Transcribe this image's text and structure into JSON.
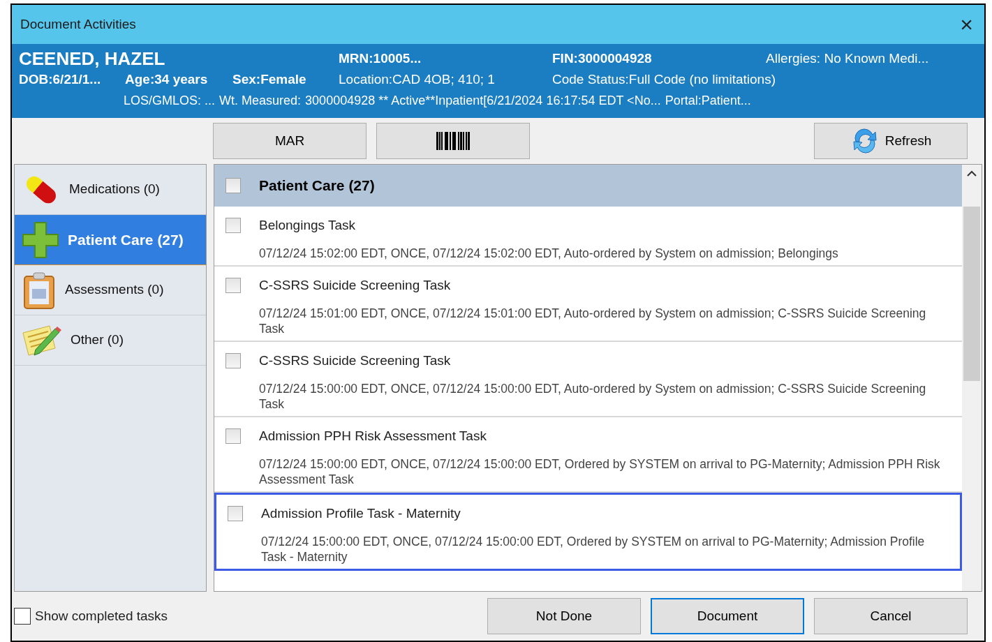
{
  "window": {
    "title": "Document Activities",
    "close": "×"
  },
  "banner": {
    "name": "CEENED, HAZEL",
    "mrn": "MRN:10005...",
    "fin": "FIN:3000004928",
    "allergies": "Allergies: No Known Medi...",
    "dob": "DOB:6/21/1...",
    "age": "Age:34 years",
    "sex": "Sex:Female",
    "location": "Location:CAD 4OB; 410; 1",
    "code_status": "Code Status:Full Code (no limitations)",
    "los": "LOS/GMLOS: ...",
    "weight": "Wt. Measured:",
    "encounter": "3000004928 ** Active**Inpatient[6/21/2024 16:17:54 EDT <No...",
    "portal": "Portal:Patient..."
  },
  "toolbar": {
    "mar": "MAR",
    "refresh": "Refresh"
  },
  "sidebar": {
    "items": [
      {
        "label": "Medications (0)",
        "kind": "pill",
        "selected": false
      },
      {
        "label": "Patient Care (27)",
        "kind": "cross",
        "selected": true
      },
      {
        "label": "Assessments (0)",
        "kind": "clipboard",
        "selected": false
      },
      {
        "label": "Other (0)",
        "kind": "note",
        "selected": false
      }
    ]
  },
  "list": {
    "header": {
      "title": "Patient Care (27)",
      "checked": false
    },
    "tasks": [
      {
        "title": "Belongings Task",
        "details": "07/12/24 15:02:00 EDT, ONCE, 07/12/24 15:02:00 EDT, Auto-ordered by System on admission; Belongings",
        "checked": false,
        "highlighted": false
      },
      {
        "title": "C-SSRS Suicide Screening Task",
        "details": "07/12/24 15:01:00 EDT, ONCE, 07/12/24 15:01:00 EDT, Auto-ordered by System on admission; C-SSRS Suicide Screening Task",
        "checked": false,
        "highlighted": false
      },
      {
        "title": "C-SSRS Suicide Screening Task",
        "details": "07/12/24 15:00:00 EDT, ONCE, 07/12/24 15:00:00 EDT, Auto-ordered by System on admission; C-SSRS Suicide Screening Task",
        "checked": false,
        "highlighted": false
      },
      {
        "title": "Admission PPH Risk Assessment Task",
        "details": "07/12/24 15:00:00 EDT, ONCE, 07/12/24 15:00:00 EDT, Ordered by SYSTEM on arrival to PG-Maternity; Admission PPH Risk Assessment Task",
        "checked": false,
        "highlighted": false
      },
      {
        "title": "Admission Profile Task - Maternity",
        "details": "07/12/24 15:00:00 EDT, ONCE, 07/12/24 15:00:00 EDT, Ordered by SYSTEM on arrival to PG-Maternity; Admission Profile Task - Maternity",
        "checked": false,
        "highlighted": true
      }
    ]
  },
  "footer": {
    "show_completed": {
      "label": "Show completed tasks",
      "checked": false
    },
    "buttons": [
      {
        "label": "Not Done",
        "selected": false
      },
      {
        "label": "Document",
        "selected": true
      },
      {
        "label": "Cancel",
        "selected": false
      }
    ]
  }
}
